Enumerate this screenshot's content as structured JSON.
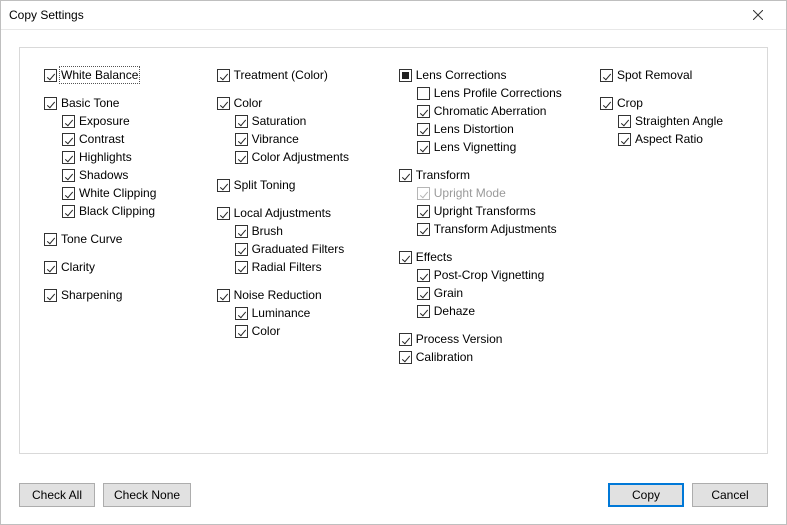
{
  "window": {
    "title": "Copy Settings"
  },
  "col1": {
    "white_balance": "White Balance",
    "basic_tone": "Basic Tone",
    "exposure": "Exposure",
    "contrast": "Contrast",
    "highlights": "Highlights",
    "shadows": "Shadows",
    "white_clipping": "White Clipping",
    "black_clipping": "Black Clipping",
    "tone_curve": "Tone Curve",
    "clarity": "Clarity",
    "sharpening": "Sharpening"
  },
  "col2": {
    "treatment": "Treatment (Color)",
    "color": "Color",
    "saturation": "Saturation",
    "vibrance": "Vibrance",
    "color_adjustments": "Color Adjustments",
    "split_toning": "Split Toning",
    "local_adjustments": "Local Adjustments",
    "brush": "Brush",
    "graduated_filters": "Graduated Filters",
    "radial_filters": "Radial Filters",
    "noise_reduction": "Noise Reduction",
    "luminance": "Luminance",
    "nr_color": "Color"
  },
  "col3": {
    "lens_corrections": "Lens Corrections",
    "lens_profile": "Lens Profile Corrections",
    "chromatic": "Chromatic Aberration",
    "lens_distortion": "Lens Distortion",
    "lens_vignetting": "Lens Vignetting",
    "transform": "Transform",
    "upright_mode": "Upright Mode",
    "upright_transforms": "Upright Transforms",
    "transform_adjustments": "Transform Adjustments",
    "effects": "Effects",
    "post_crop": "Post-Crop Vignetting",
    "grain": "Grain",
    "dehaze": "Dehaze",
    "process_version": "Process Version",
    "calibration": "Calibration"
  },
  "col4": {
    "spot_removal": "Spot Removal",
    "crop": "Crop",
    "straighten": "Straighten Angle",
    "aspect": "Aspect Ratio"
  },
  "buttons": {
    "check_all": "Check All",
    "check_none": "Check None",
    "copy": "Copy",
    "cancel": "Cancel"
  }
}
